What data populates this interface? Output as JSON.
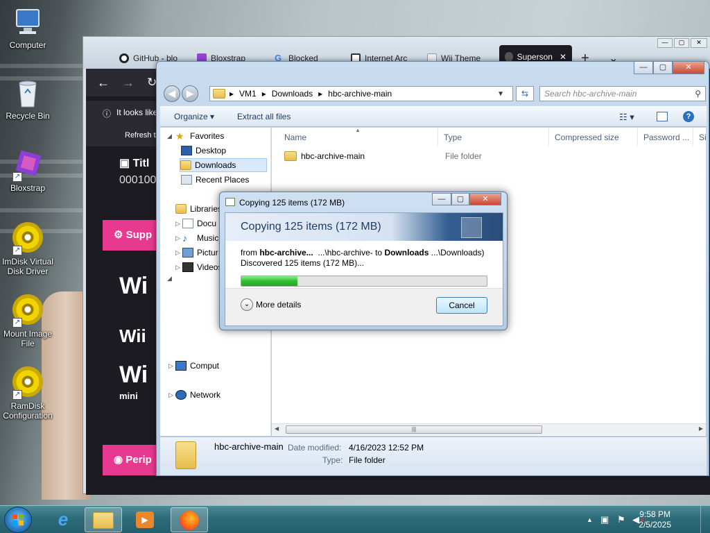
{
  "desktop": {
    "icons": [
      {
        "label": "Computer",
        "icon": "computer-icon"
      },
      {
        "label": "Recycle Bin",
        "icon": "recycle-bin-icon"
      },
      {
        "label": "Bloxstrap",
        "icon": "bloxstrap-icon"
      },
      {
        "label": "ImDisk Virtual Disk Driver",
        "icon": "disc-icon"
      },
      {
        "label": "Mount Image File",
        "icon": "disc-icon"
      },
      {
        "label": "RamDisk Configuration",
        "icon": "disc-icon"
      }
    ]
  },
  "browser": {
    "tabs": [
      {
        "label": "GitHub - blo",
        "icon": "github-icon"
      },
      {
        "label": "Bloxstrap",
        "icon": "bloxstrap-icon"
      },
      {
        "label": "Blocked",
        "icon": "google-icon"
      },
      {
        "label": "Internet Arc",
        "icon": "archive-icon"
      },
      {
        "label": "Wii Theme",
        "icon": "wii-icon"
      },
      {
        "label": "Superson",
        "icon": "supersonic-icon",
        "active": true
      }
    ],
    "new_tab": "+",
    "tab_list": "⌄",
    "notice_text": "It looks like",
    "notice_refresh": "Refresh t",
    "page_title_fragment": "Titl",
    "page_id_fragment": "000100",
    "supp_label": "Supp",
    "wii_1": "Wi",
    "wii_2": "Wii",
    "wii_3": "Wi",
    "wii_mini": "mini",
    "perip_label": "Perip"
  },
  "explorer": {
    "window_controls": [
      "—",
      "▢",
      "✕"
    ],
    "breadcrumb": [
      "VM1",
      "Downloads",
      "hbc-archive-main"
    ],
    "search_placeholder": "Search hbc-archive-main",
    "toolbar": {
      "organize": "Organize ▾",
      "extract": "Extract all files"
    },
    "nav": {
      "favorites": "Favorites",
      "desktop": "Desktop",
      "downloads": "Downloads",
      "recent": "Recent Places",
      "libraries": "Libraries",
      "documents": "Docu",
      "music": "Music",
      "pictures": "Pictur",
      "videos": "Videos",
      "computer": "Comput",
      "network": "Network"
    },
    "columns": [
      "Name",
      "Type",
      "Compressed size",
      "Password ...",
      "Si"
    ],
    "files": [
      {
        "name": "hbc-archive-main",
        "type": "File folder"
      }
    ],
    "details": {
      "name": "hbc-archive-main",
      "modified_label": "Date modified:",
      "modified_value": "4/16/2023 12:52 PM",
      "type_label": "Type:",
      "type_value": "File folder"
    }
  },
  "copy_dialog": {
    "title": "Copying 125 items (172 MB)",
    "heading": "Copying 125 items (172 MB)",
    "from_prefix": "from",
    "from_source": "hbc-archive...",
    "from_path": "...\\hbc-archive- to",
    "to_dest": "Downloads",
    "to_path": "...\\Downloads)",
    "discovered": "Discovered 125 items (172 MB)...",
    "progress_percent": 23,
    "more_details": "More details",
    "cancel": "Cancel"
  },
  "taskbar": {
    "clock_time": "9:58 PM",
    "clock_date": "2/5/2025",
    "tray_arrow": "▲"
  }
}
